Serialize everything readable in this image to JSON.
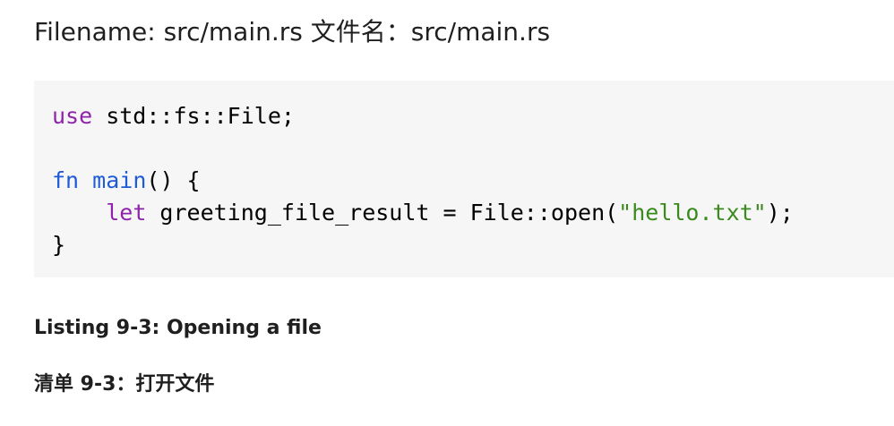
{
  "filename": {
    "text": "Filename: src/main.rs 文件名：src/main.rs"
  },
  "code": {
    "line1": {
      "keyword": "use",
      "rest": " std::fs::File;"
    },
    "line2": {
      "text": ""
    },
    "line3": {
      "keyword": "fn",
      "space": " ",
      "name": "main",
      "rest": "() {"
    },
    "line4": {
      "indent": "    ",
      "keyword": "let",
      "middle": " greeting_file_result = File::open(",
      "string": "\"hello.txt\"",
      "end": ");"
    },
    "line5": {
      "text": "}"
    }
  },
  "captions": {
    "english": "Listing 9-3: Opening a file",
    "chinese": "清单 9-3：打开文件"
  },
  "colors": {
    "keyword": "#8e24aa",
    "function": "#1f5bd6",
    "string": "#3b8a1e",
    "code_background": "#f6f6f6"
  }
}
